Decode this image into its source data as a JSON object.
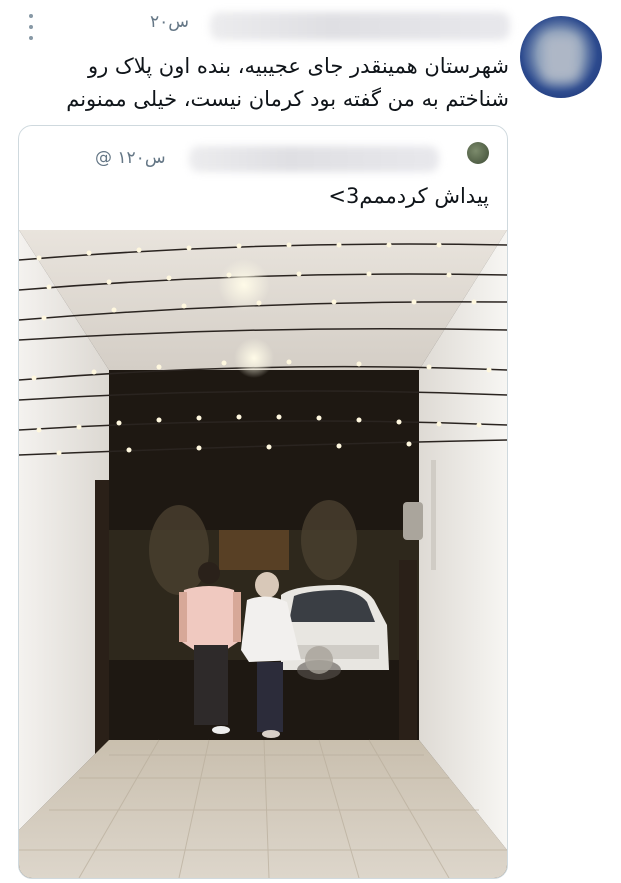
{
  "tweet": {
    "time": "۲۰س",
    "text": "شهرستان همینقدر جای عجیبیه، بنده اون پلاک رو شناختم به من گفته بود کرمان نیست، خیلی ممنونم"
  },
  "quoted_tweet": {
    "handle_prefix": "@",
    "time": "۱۲۰س",
    "text": "پیداش کردممم3>"
  },
  "icons": {
    "more": "more-vertical-icon",
    "avatar": "avatar",
    "photo": "alley-photo"
  }
}
